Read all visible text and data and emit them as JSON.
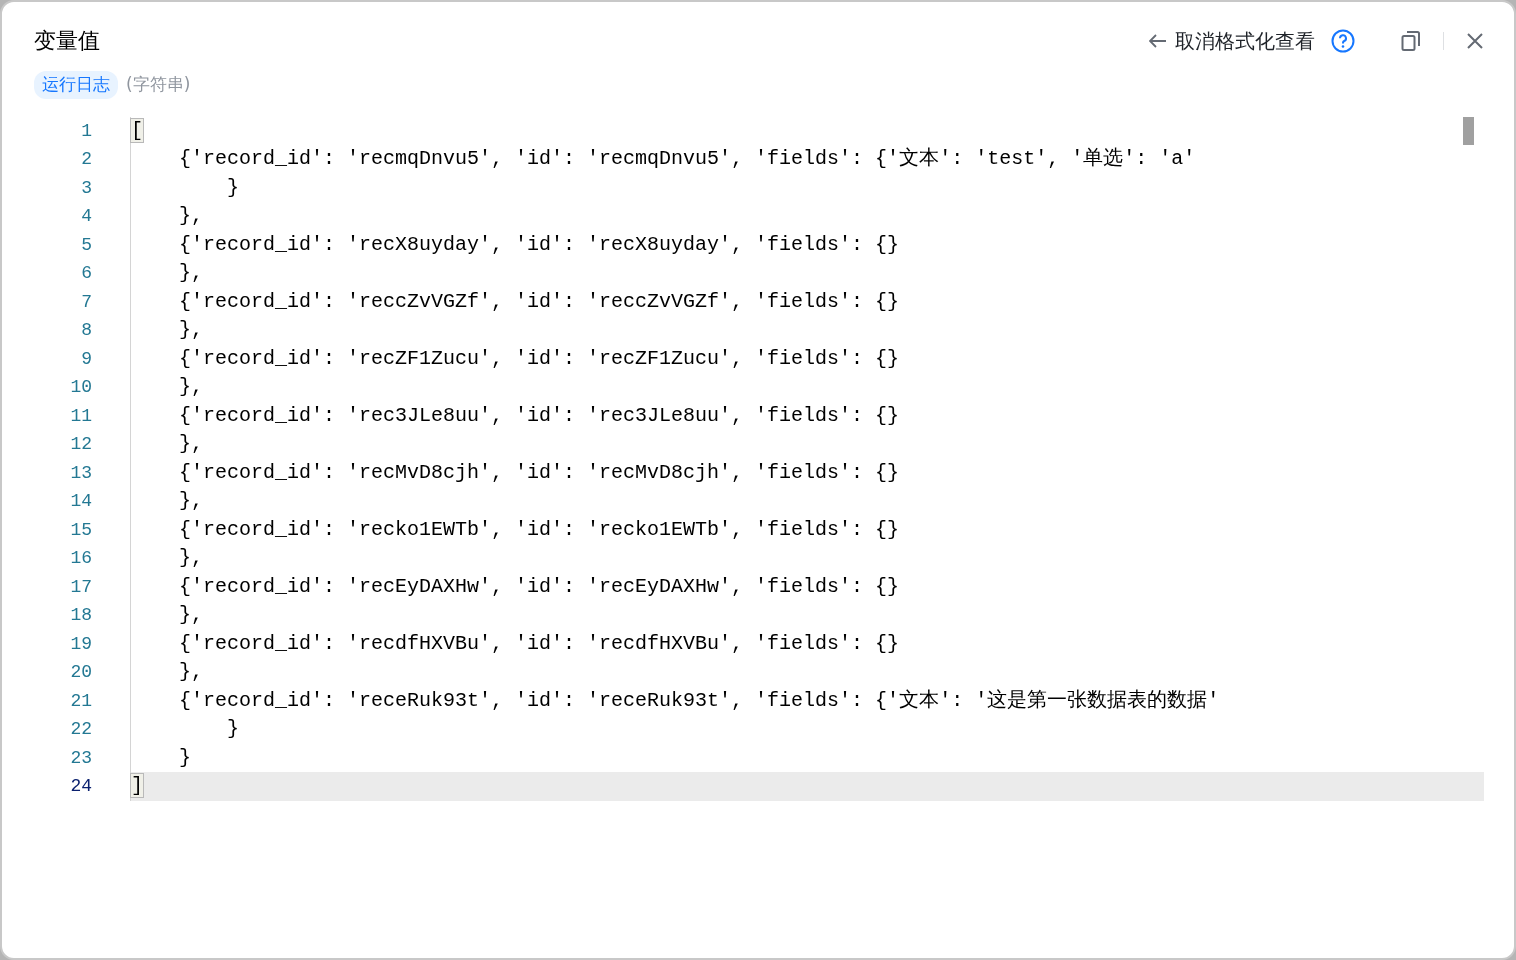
{
  "dialog": {
    "title": "变量值",
    "unformat_label": "取消格式化查看"
  },
  "variable": {
    "name": "运行日志",
    "type": "(字符串)"
  },
  "editor": {
    "lines": [
      {
        "number": "1",
        "text": "[",
        "current": false,
        "bracket_match": true
      },
      {
        "number": "2",
        "text": "    {'record_id': 'recmqDnvu5', 'id': 'recmqDnvu5', 'fields': {'文本': 'test', '单选': 'a'",
        "current": false,
        "bracket_match": false
      },
      {
        "number": "3",
        "text": "        }",
        "current": false,
        "bracket_match": false
      },
      {
        "number": "4",
        "text": "    },",
        "current": false,
        "bracket_match": false
      },
      {
        "number": "5",
        "text": "    {'record_id': 'recX8uyday', 'id': 'recX8uyday', 'fields': {}",
        "current": false,
        "bracket_match": false
      },
      {
        "number": "6",
        "text": "    },",
        "current": false,
        "bracket_match": false
      },
      {
        "number": "7",
        "text": "    {'record_id': 'reccZvVGZf', 'id': 'reccZvVGZf', 'fields': {}",
        "current": false,
        "bracket_match": false
      },
      {
        "number": "8",
        "text": "    },",
        "current": false,
        "bracket_match": false
      },
      {
        "number": "9",
        "text": "    {'record_id': 'recZF1Zucu', 'id': 'recZF1Zucu', 'fields': {}",
        "current": false,
        "bracket_match": false
      },
      {
        "number": "10",
        "text": "    },",
        "current": false,
        "bracket_match": false
      },
      {
        "number": "11",
        "text": "    {'record_id': 'rec3JLe8uu', 'id': 'rec3JLe8uu', 'fields': {}",
        "current": false,
        "bracket_match": false
      },
      {
        "number": "12",
        "text": "    },",
        "current": false,
        "bracket_match": false
      },
      {
        "number": "13",
        "text": "    {'record_id': 'recMvD8cjh', 'id': 'recMvD8cjh', 'fields': {}",
        "current": false,
        "bracket_match": false
      },
      {
        "number": "14",
        "text": "    },",
        "current": false,
        "bracket_match": false
      },
      {
        "number": "15",
        "text": "    {'record_id': 'recko1EWTb', 'id': 'recko1EWTb', 'fields': {}",
        "current": false,
        "bracket_match": false
      },
      {
        "number": "16",
        "text": "    },",
        "current": false,
        "bracket_match": false
      },
      {
        "number": "17",
        "text": "    {'record_id': 'recEyDAXHw', 'id': 'recEyDAXHw', 'fields': {}",
        "current": false,
        "bracket_match": false
      },
      {
        "number": "18",
        "text": "    },",
        "current": false,
        "bracket_match": false
      },
      {
        "number": "19",
        "text": "    {'record_id': 'recdfHXVBu', 'id': 'recdfHXVBu', 'fields': {}",
        "current": false,
        "bracket_match": false
      },
      {
        "number": "20",
        "text": "    },",
        "current": false,
        "bracket_match": false
      },
      {
        "number": "21",
        "text": "    {'record_id': 'receRuk93t', 'id': 'receRuk93t', 'fields': {'文本': '这是第一张数据表的数据'",
        "current": false,
        "bracket_match": false
      },
      {
        "number": "22",
        "text": "        }",
        "current": false,
        "bracket_match": false
      },
      {
        "number": "23",
        "text": "    }",
        "current": false,
        "bracket_match": false
      },
      {
        "number": "24",
        "text": "]",
        "current": true,
        "bracket_match": true
      }
    ]
  }
}
